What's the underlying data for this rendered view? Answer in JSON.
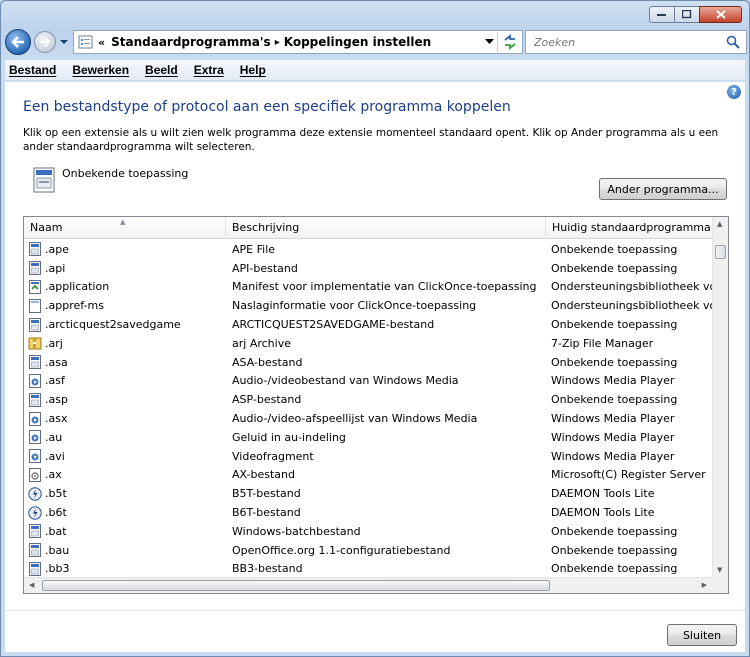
{
  "nav": {
    "breadcrumb_overflow": "«",
    "crumbs": [
      "Standaardprogramma's",
      "Koppelingen instellen"
    ],
    "search_placeholder": "Zoeken"
  },
  "menu": [
    "Bestand",
    "Bewerken",
    "Beeld",
    "Extra",
    "Help"
  ],
  "page": {
    "heading": "Een bestandstype of protocol aan een specifiek programma koppelen",
    "description": "Klik op een extensie als u wilt zien welk programma deze extensie momenteel standaard opent. Klik op Ander programma als u een ander standaardprogramma wilt selecteren.",
    "current_program": "Onbekende toepassing",
    "change_button": "Ander programma...",
    "close_button": "Sluiten"
  },
  "list": {
    "columns": [
      "Naam",
      "Beschrijving",
      "Huidig standaardprogramma"
    ],
    "rows": [
      {
        "name": ".ape",
        "desc": "APE File",
        "program": "Onbekende toepassing",
        "icon": "generic-file-icon"
      },
      {
        "name": ".api",
        "desc": "API-bestand",
        "program": "Onbekende toepassing",
        "icon": "generic-file-icon"
      },
      {
        "name": ".application",
        "desc": "Manifest voor implementatie van ClickOnce-toepassing",
        "program": "Ondersteuningsbibliotheek voor",
        "icon": "clickonce-icon"
      },
      {
        "name": ".appref-ms",
        "desc": "Naslaginformatie voor ClickOnce-toepassing",
        "program": "Ondersteuningsbibliotheek voor",
        "icon": "blank-file-icon"
      },
      {
        "name": ".arcticquest2savedgame",
        "desc": "ARCTICQUEST2SAVEDGAME-bestand",
        "program": "Onbekende toepassing",
        "icon": "generic-file-icon"
      },
      {
        "name": ".arj",
        "desc": "arj Archive",
        "program": "7-Zip File Manager",
        "icon": "archive-icon"
      },
      {
        "name": ".asa",
        "desc": "ASA-bestand",
        "program": "Onbekende toepassing",
        "icon": "generic-file-icon"
      },
      {
        "name": ".asf",
        "desc": "Audio-/videobestand van Windows Media",
        "program": "Windows Media Player",
        "icon": "media-file-icon"
      },
      {
        "name": ".asp",
        "desc": "ASP-bestand",
        "program": "Onbekende toepassing",
        "icon": "generic-file-icon"
      },
      {
        "name": ".asx",
        "desc": "Audio-/video-afspeellijst van Windows Media",
        "program": "Windows Media Player",
        "icon": "media-file-icon"
      },
      {
        "name": ".au",
        "desc": "Geluid in au-indeling",
        "program": "Windows Media Player",
        "icon": "media-file-icon"
      },
      {
        "name": ".avi",
        "desc": "Videofragment",
        "program": "Windows Media Player",
        "icon": "media-file-icon"
      },
      {
        "name": ".ax",
        "desc": "AX-bestand",
        "program": "Microsoft(C) Register Server",
        "icon": "system-file-icon"
      },
      {
        "name": ".b5t",
        "desc": "B5T-bestand",
        "program": "DAEMON Tools Lite",
        "icon": "daemon-tools-icon"
      },
      {
        "name": ".b6t",
        "desc": "B6T-bestand",
        "program": "DAEMON Tools Lite",
        "icon": "daemon-tools-icon"
      },
      {
        "name": ".bat",
        "desc": "Windows-batchbestand",
        "program": "Onbekende toepassing",
        "icon": "generic-file-icon"
      },
      {
        "name": ".bau",
        "desc": "OpenOffice.org 1.1-configuratiebestand",
        "program": "Onbekende toepassing",
        "icon": "generic-file-icon"
      },
      {
        "name": ".bb3",
        "desc": "BB3-bestand",
        "program": "Onbekende toepassing",
        "icon": "generic-file-icon"
      }
    ]
  }
}
